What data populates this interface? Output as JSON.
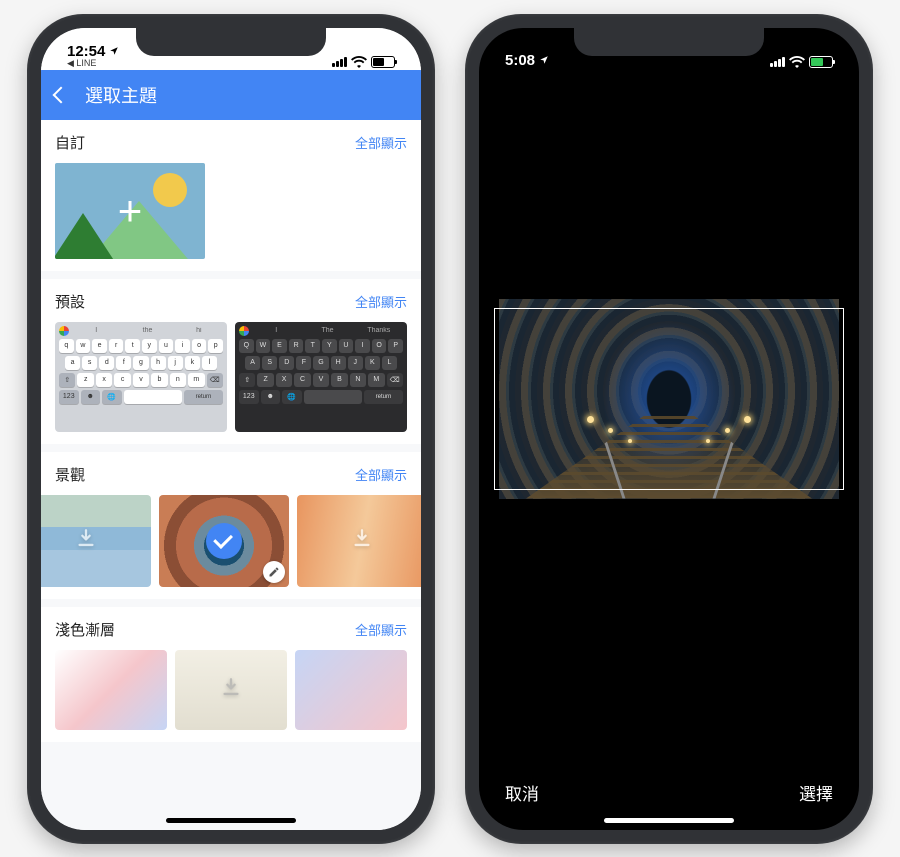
{
  "phone1": {
    "status": {
      "time": "12:54",
      "back_app": "LINE",
      "battery_pct": 55,
      "charging": false
    },
    "header": {
      "title": "選取主題"
    },
    "sections": {
      "custom": {
        "title": "自訂",
        "more": "全部顯示"
      },
      "preset": {
        "title": "預設",
        "more": "全部顯示",
        "suggestion_words": [
          "I",
          "the",
          "hi"
        ],
        "suggestion_words_dark": [
          "I",
          "The",
          "Thanks"
        ]
      },
      "landscape": {
        "title": "景觀",
        "more": "全部顯示"
      },
      "gradient": {
        "title": "淺色漸層",
        "more": "全部顯示"
      }
    }
  },
  "phone2": {
    "status": {
      "time": "5:08",
      "battery_pct": 60,
      "charging": true
    },
    "footer": {
      "cancel": "取消",
      "select": "選擇"
    }
  }
}
